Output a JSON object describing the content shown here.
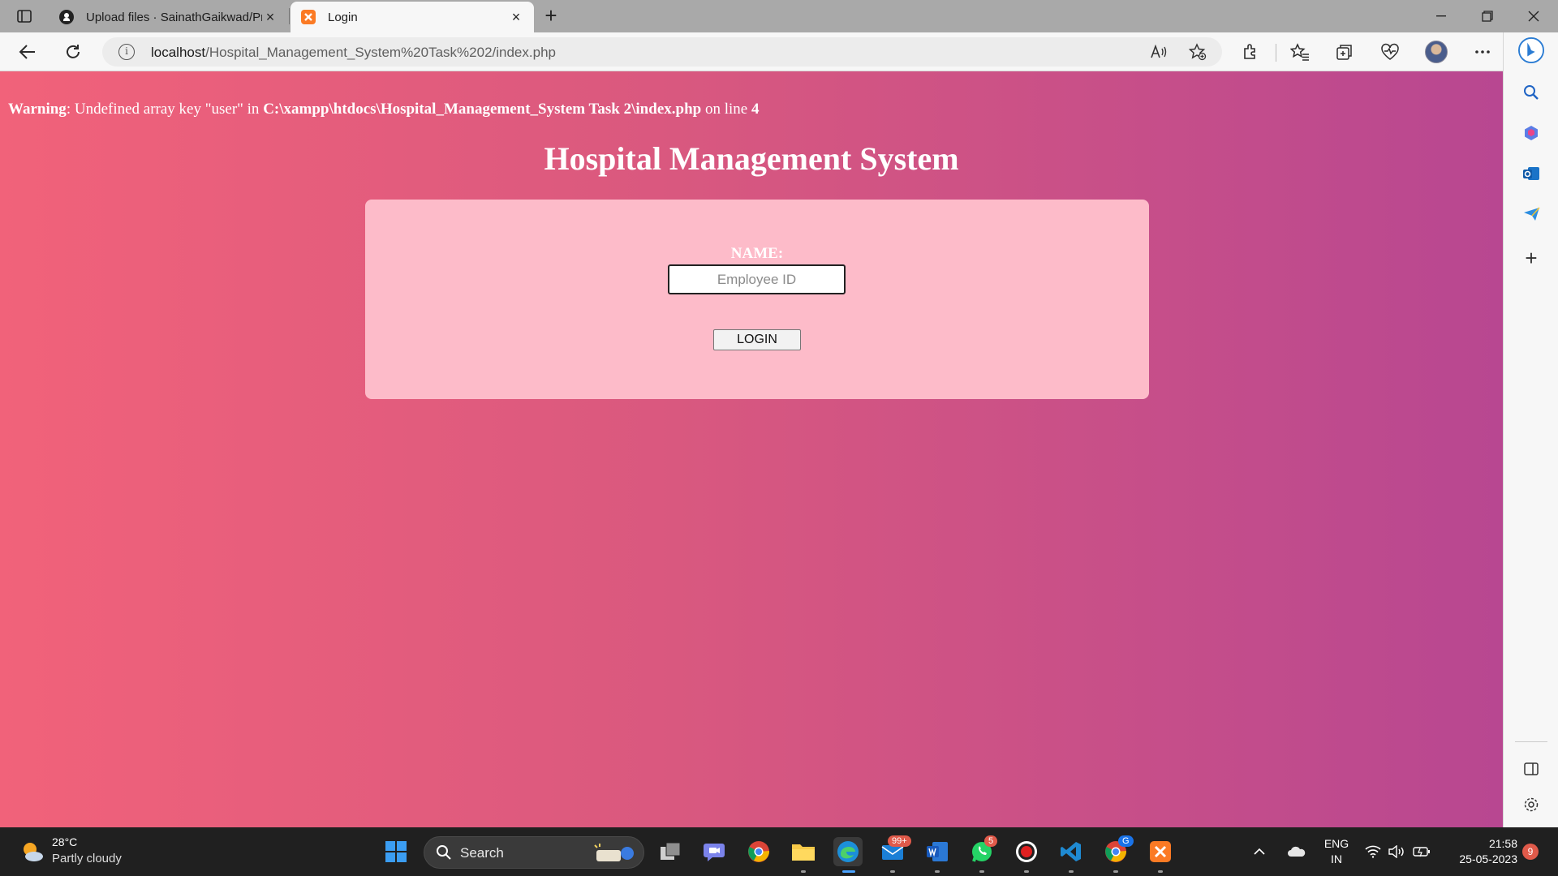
{
  "browser": {
    "tabs": [
      {
        "title": "Upload files · SainathGaikwad/Pr",
        "favicon": "github-icon",
        "active": false
      },
      {
        "title": "Login",
        "favicon": "xampp-icon",
        "active": true
      }
    ],
    "url_host": "localhost",
    "url_path": "/Hospital_Management_System%20Task%202/index.php"
  },
  "page": {
    "warning": {
      "prefix": "Warning",
      "message": ": Undefined array key \"user\" in ",
      "file": "C:\\xampp\\htdocs\\Hospital_Management_System Task 2\\index.php",
      "line_text": " on line ",
      "line": "4"
    },
    "title": "Hospital Management System",
    "form": {
      "name_label": "NAME:",
      "employee_placeholder": "Employee ID",
      "login_label": "LOGIN"
    }
  },
  "taskbar": {
    "weather_temp": "28°C",
    "weather_desc": "Partly cloudy",
    "search_label": "Search",
    "mail_badge": "99+",
    "whatsapp_badge": "5",
    "chrome_badge": "G",
    "lang_top": "ENG",
    "lang_bottom": "IN",
    "time": "21:58",
    "date": "25-05-2023",
    "notification_count": "9"
  },
  "colors": {
    "gradient_start": "#f1627a",
    "gradient_end": "#b84791",
    "card": "#fdbbc9"
  }
}
